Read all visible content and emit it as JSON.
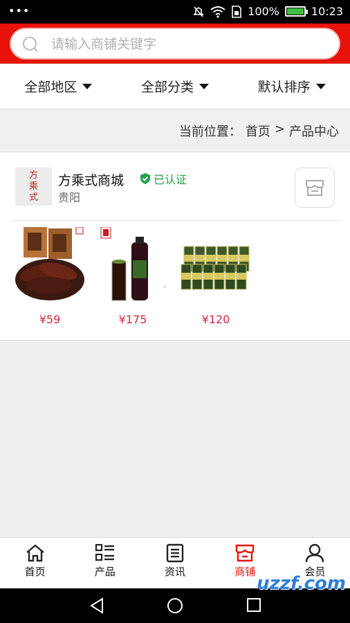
{
  "status": {
    "battery": "100%",
    "time": "10:23",
    "battery_level": 1.0
  },
  "search": {
    "placeholder": "请输入商铺关键字"
  },
  "filters": [
    {
      "label": "全部地区"
    },
    {
      "label": "全部分类"
    },
    {
      "label": "默认排序"
    }
  ],
  "breadcrumb": {
    "prefix": "当前位置：",
    "home": "首页",
    "sep": ">",
    "current": "产品中心"
  },
  "shop": {
    "logo_text": "方乘式",
    "name": "方乘式商城",
    "verified_label": "已认证",
    "city": "贵阳",
    "products": [
      {
        "price": "¥59",
        "icon": "sausage-product-image"
      },
      {
        "price": "¥175",
        "icon": "bottled-drink-product-image"
      },
      {
        "price": "¥120",
        "icon": "canned-drink-product-image"
      }
    ]
  },
  "tabs": [
    {
      "label": "首页",
      "icon": "home-icon"
    },
    {
      "label": "产品",
      "icon": "list-icon"
    },
    {
      "label": "资讯",
      "icon": "news-icon"
    },
    {
      "label": "商铺",
      "icon": "store-icon",
      "active": true
    },
    {
      "label": "会员",
      "icon": "user-icon"
    }
  ],
  "watermark": "uzzf.com",
  "colors": {
    "brand_red": "#e8120b",
    "price_red": "#d7263d",
    "verified_green": "#22a24a"
  }
}
